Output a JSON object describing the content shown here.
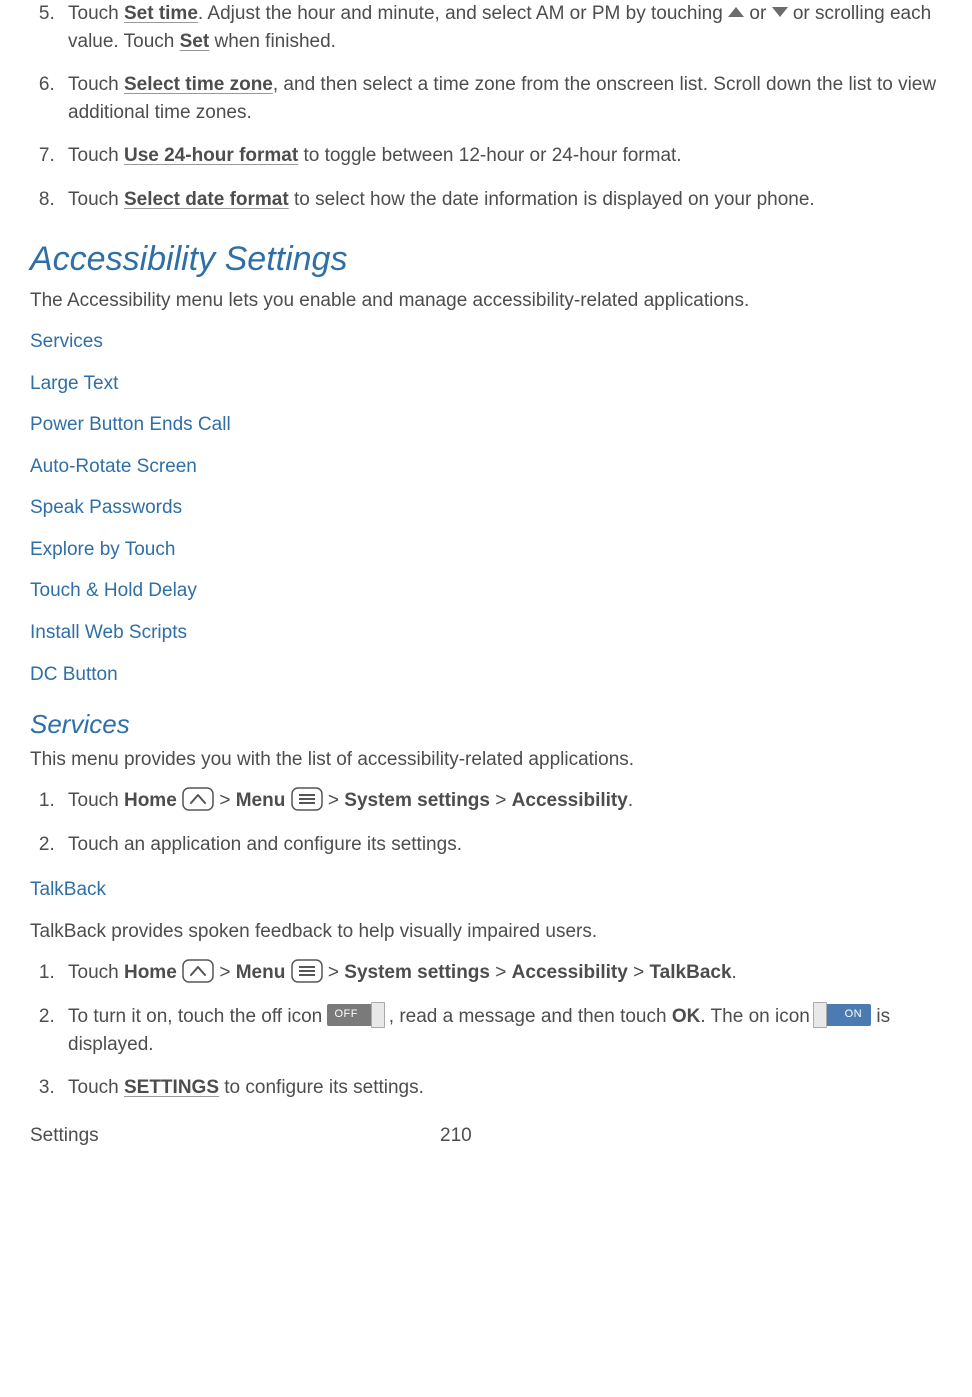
{
  "steps_part1": {
    "s5": {
      "num": "5.",
      "a": "Touch ",
      "bold1": "Set time",
      "b": ". Adjust the hour and minute, and select AM or PM by touching ",
      "c": " or ",
      "d": " or scrolling each value. Touch ",
      "bold2": "Set",
      "e": " when finished."
    },
    "s6": {
      "num": "6.",
      "a": "Touch ",
      "bold1": "Select time zone",
      "b": ", and then select a time zone from the onscreen list. Scroll down the list to view additional time zones."
    },
    "s7": {
      "num": "7.",
      "a": "Touch ",
      "bold1": "Use 24-hour format",
      "b": " to toggle between 12-hour or 24-hour format."
    },
    "s8": {
      "num": "8.",
      "a": "Touch ",
      "bold1": "Select date format",
      "b": " to select how the date information is displayed on your phone."
    }
  },
  "accessibility": {
    "heading": "Accessibility Settings",
    "desc": "The Accessibility menu lets you enable and manage accessibility-related applications.",
    "links": [
      "Services",
      "Large Text",
      "Power Button Ends Call",
      "Auto-Rotate Screen",
      "Speak Passwords",
      "Explore by Touch",
      "Touch & Hold Delay",
      "Install Web Scripts",
      "DC Button"
    ]
  },
  "services": {
    "heading": "Services",
    "desc": "This menu provides you with the list of accessibility-related applications.",
    "s1": {
      "a": "Touch ",
      "home": "Home",
      "gt1": " > ",
      "menu": "Menu",
      "gt2": " > ",
      "sys": "System settings",
      "gt3": " > ",
      "acc": "Accessibility",
      "dot": "."
    },
    "s2": "Touch an application and configure its settings."
  },
  "talkback": {
    "heading": "TalkBack",
    "desc": "TalkBack provides spoken feedback to help visually impaired users.",
    "s1": {
      "a": "Touch ",
      "home": "Home",
      "gt1": " > ",
      "menu": "Menu",
      "gt2": " > ",
      "sys": "System settings",
      "gt3": " > ",
      "acc": "Accessibility",
      "gt4": " > ",
      "tb": "TalkBack",
      "dot": "."
    },
    "s2": {
      "a": "To turn it on, touch the off icon ",
      "b": " , read a message and then touch ",
      "ok": "OK",
      "c": ".  The on icon ",
      "d": " is displayed."
    },
    "s3": {
      "a": "Touch ",
      "bold": "SETTINGS",
      "b": " to configure its settings."
    }
  },
  "switch_labels": {
    "off": "OFF",
    "on": "ON"
  },
  "footer": {
    "section": "Settings",
    "page": "210"
  }
}
